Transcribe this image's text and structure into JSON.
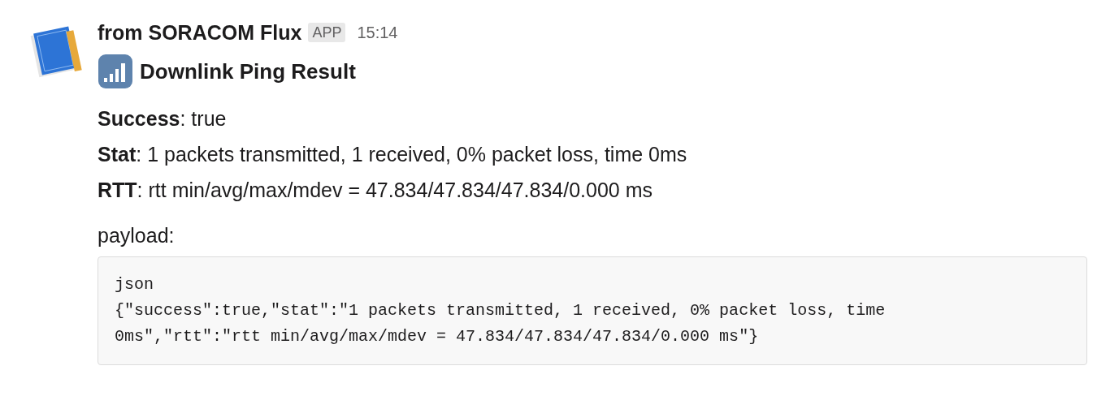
{
  "message": {
    "sender": "from SORACOM Flux",
    "badge": "APP",
    "time": "15:14",
    "title": "Downlink Ping Result",
    "fields": [
      "**Success**: true",
      "**Stat**: 1 packets transmitted, 1 received, 0% packet loss, time 0ms",
      "**RTT**: rtt min/avg/max/mdev = 47.834/47.834/47.834/0.000 ms"
    ],
    "payload_label": "payload:",
    "code_lines": [
      "json",
      "{\"success\":true,\"stat\":\"1 packets transmitted, 1 received, 0% packet loss, time",
      "0ms\",\"rtt\":\"rtt min/avg/max/mdev = 47.834/47.834/47.834/0.000 ms\"}"
    ]
  }
}
